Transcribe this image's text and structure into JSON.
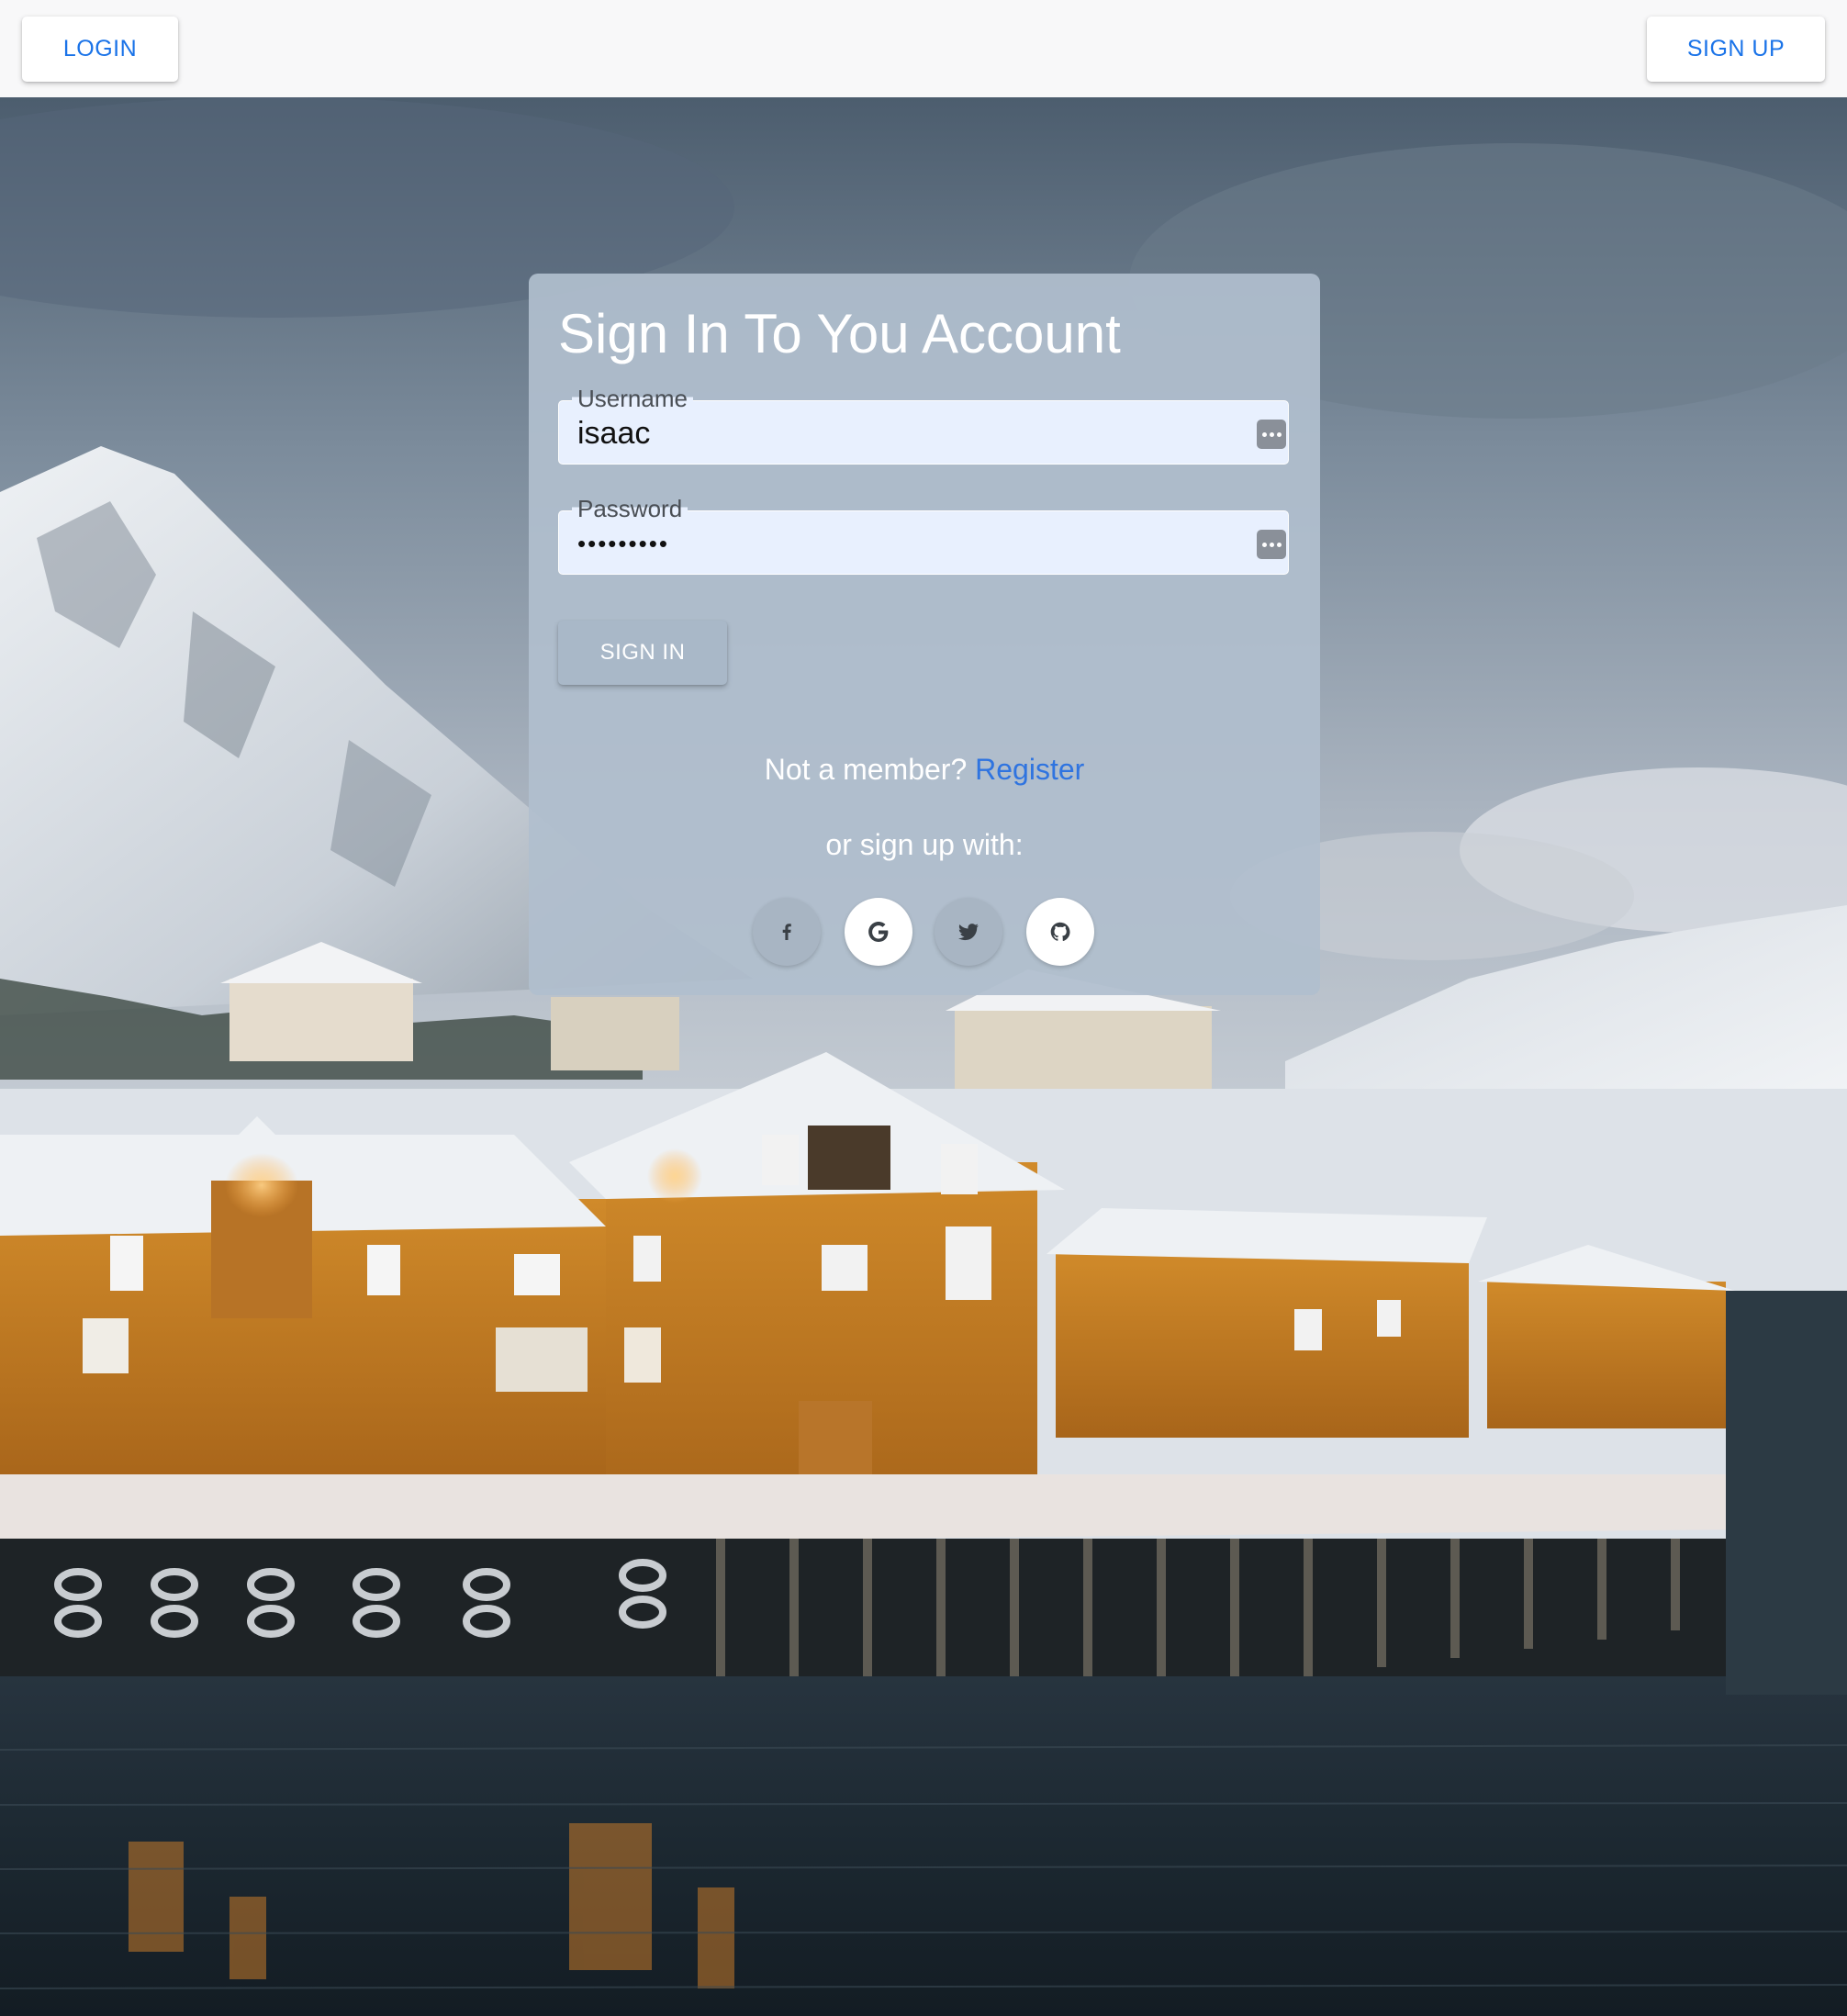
{
  "nav": {
    "login_label": "LOGIN",
    "signup_label": "SIGN UP"
  },
  "form": {
    "title": "Sign In To You Account",
    "username": {
      "label": "Username",
      "value": "isaac"
    },
    "password": {
      "label": "Password",
      "value": "•••••••••"
    },
    "submit_label": "SIGN IN"
  },
  "footer": {
    "member_text": "Not a member?",
    "register_link": "Register",
    "or_text": "or sign up with:"
  },
  "social": [
    {
      "name": "facebook",
      "icon": "facebook-icon"
    },
    {
      "name": "google",
      "icon": "google-icon"
    },
    {
      "name": "twitter",
      "icon": "twitter-icon"
    },
    {
      "name": "github",
      "icon": "github-icon"
    }
  ],
  "colors": {
    "accent": "#1a73e8",
    "link": "#2f74e0",
    "topbar_bg": "#f8f8f9",
    "input_bg": "#e8f0fe"
  }
}
